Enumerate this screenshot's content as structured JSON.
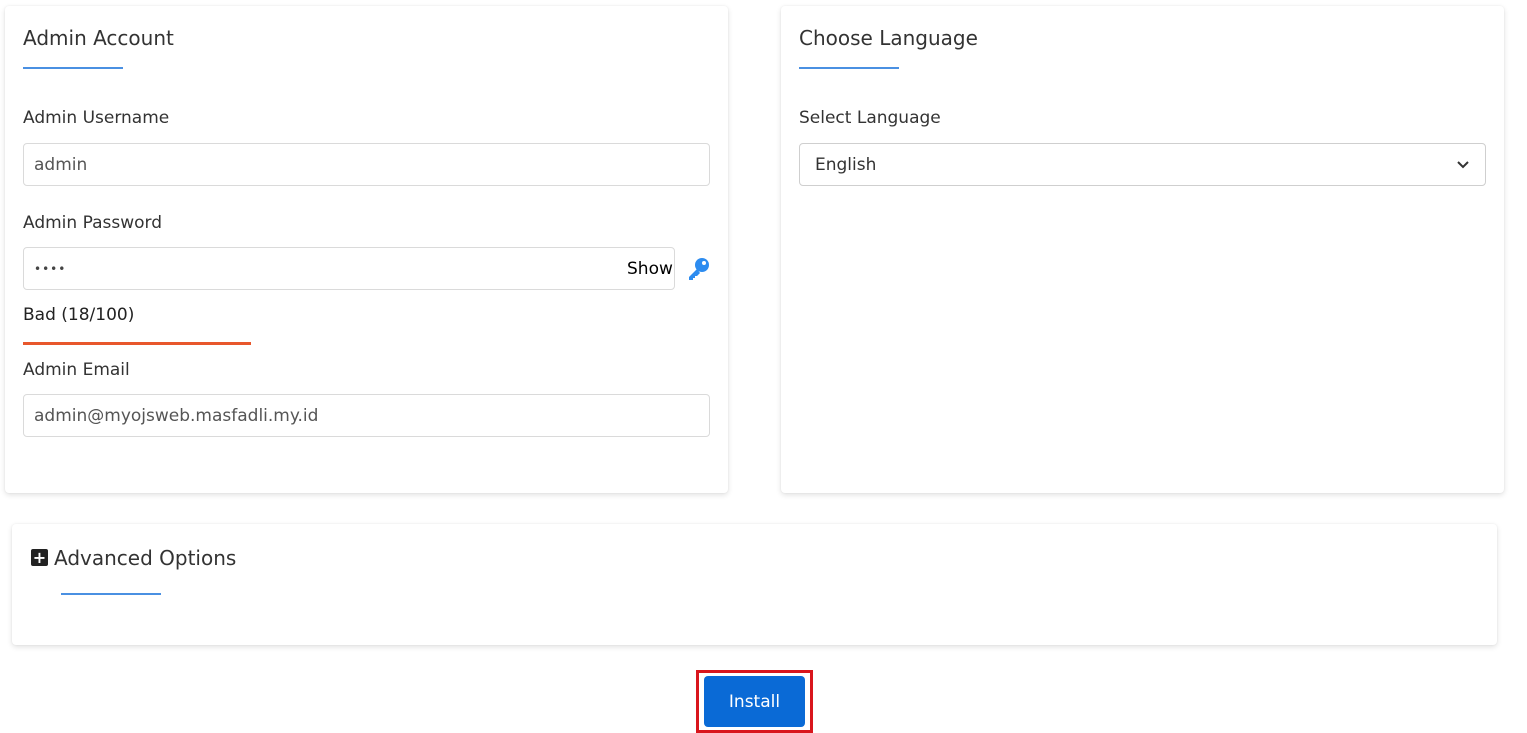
{
  "admin_account": {
    "title": "Admin Account",
    "username_label": "Admin Username",
    "username_value": "admin",
    "password_label": "Admin Password",
    "password_value": "••••",
    "show_label": "Show",
    "strength_text": "Bad (18/100)",
    "strength_score": 18,
    "strength_color": "#e8572c",
    "email_label": "Admin Email",
    "email_value": "admin@myojsweb.masfadli.my.id",
    "key_icon": "key-icon"
  },
  "language": {
    "title": "Choose Language",
    "select_label": "Select Language",
    "selected_value": "English"
  },
  "advanced": {
    "title": "Advanced Options",
    "icon": "plus-square-icon"
  },
  "install": {
    "label": "Install",
    "button_color": "#0a6ad6",
    "highlight_color": "#d9161d"
  },
  "colors": {
    "accent": "#4a90e2"
  }
}
